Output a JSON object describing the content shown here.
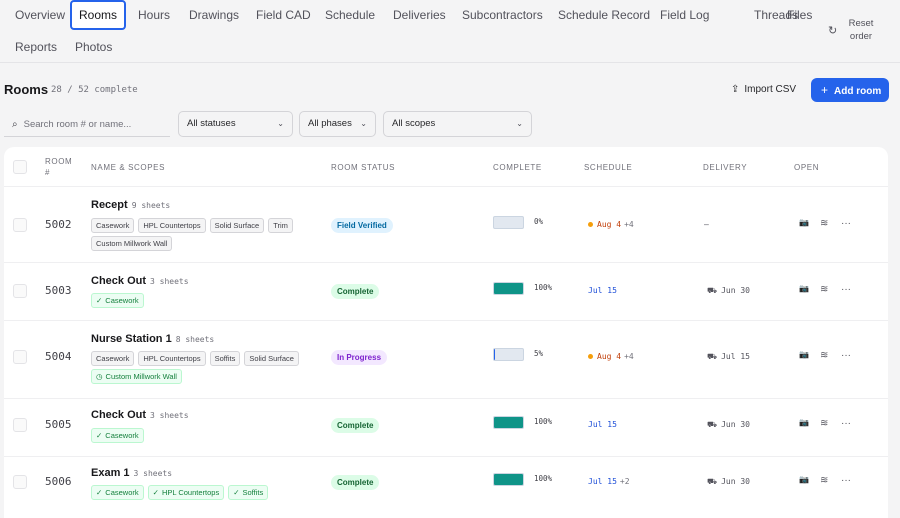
{
  "nav": {
    "tabs": [
      "Overview",
      "Rooms",
      "Hours",
      "Drawings",
      "Field CAD",
      "Schedule",
      "Deliveries",
      "Subcontractors",
      "Schedule Record",
      "Field Log",
      "Threads",
      "Files",
      "Reports",
      "Photos"
    ],
    "active_tab": "Rooms",
    "reset_label": "Reset order",
    "reset_icon": "reset-icon"
  },
  "header": {
    "title": "Rooms",
    "progress": "28 / 52 complete",
    "import_label": "Import CSV",
    "import_icon": "upload-icon",
    "add_label": "Add room",
    "add_icon": "plus-icon",
    "accent": "#2563eb"
  },
  "filters": {
    "search_placeholder": "Search room # or name...",
    "search_icon": "search-icon",
    "status": "All statuses",
    "phase": "All phases",
    "scope": "All scopes"
  },
  "table": {
    "columns": {
      "room": "ROOM #",
      "name": "NAME & SCOPES",
      "status": "ROOM STATUS",
      "complete": "COMPLETE",
      "schedule": "SCHEDULE",
      "delivery": "DELIVERY",
      "open": "OPEN"
    },
    "rows": [
      {
        "room": "5002",
        "name": "Recept",
        "sheets": "9 sheets",
        "scopes": [
          {
            "label": "Casework",
            "done": false
          },
          {
            "label": "HPL Countertops",
            "done": false
          },
          {
            "label": "Solid Surface",
            "done": false
          },
          {
            "label": "Trim",
            "done": false
          },
          {
            "label": "Custom Millwork Wall",
            "done": false
          }
        ],
        "status": "Field Verified",
        "status_kind": "field",
        "complete": 0,
        "complete_label": "0%",
        "schedule": "Aug 4",
        "schedule_extra": "+4",
        "schedule_late": true,
        "delivery": "—",
        "delivery_icon": false
      },
      {
        "room": "5003",
        "name": "Check Out",
        "sheets": "3 sheets",
        "scopes": [
          {
            "label": "Casework",
            "done": true
          }
        ],
        "status": "Complete",
        "status_kind": "complete",
        "complete": 100,
        "complete_label": "100%",
        "schedule": "Jul 15",
        "schedule_extra": "",
        "schedule_late": false,
        "delivery": "Jun 30",
        "delivery_icon": true
      },
      {
        "room": "5004",
        "name": "Nurse Station 1",
        "sheets": "8 sheets",
        "scopes": [
          {
            "label": "Casework",
            "done": false
          },
          {
            "label": "HPL Countertops",
            "done": false
          },
          {
            "label": "Soffits",
            "done": false
          },
          {
            "label": "Solid Surface",
            "done": false
          },
          {
            "label": "Custom Millwork Wall",
            "done": "partial"
          }
        ],
        "status": "In Progress",
        "status_kind": "progress",
        "complete": 5,
        "complete_label": "5%",
        "schedule": "Aug 4",
        "schedule_extra": "+4",
        "schedule_late": true,
        "delivery": "Jul 15",
        "delivery_icon": true
      },
      {
        "room": "5005",
        "name": "Check Out",
        "sheets": "3 sheets",
        "scopes": [
          {
            "label": "Casework",
            "done": true
          }
        ],
        "status": "Complete",
        "status_kind": "complete",
        "complete": 100,
        "complete_label": "100%",
        "schedule": "Jul 15",
        "schedule_extra": "",
        "schedule_late": false,
        "delivery": "Jun 30",
        "delivery_icon": true
      },
      {
        "room": "5006",
        "name": "Exam 1",
        "sheets": "3 sheets",
        "scopes": [
          {
            "label": "Casework",
            "done": true
          },
          {
            "label": "HPL Countertops",
            "done": true
          },
          {
            "label": "Soffits",
            "done": true
          }
        ],
        "status": "Complete",
        "status_kind": "complete",
        "complete": 100,
        "complete_label": "100%",
        "schedule": "Jul 15",
        "schedule_extra": "+2",
        "schedule_late": false,
        "delivery": "Jun 30",
        "delivery_icon": true
      }
    ],
    "row_icons": [
      "camera-icon",
      "layers-icon",
      "more-icon"
    ]
  }
}
